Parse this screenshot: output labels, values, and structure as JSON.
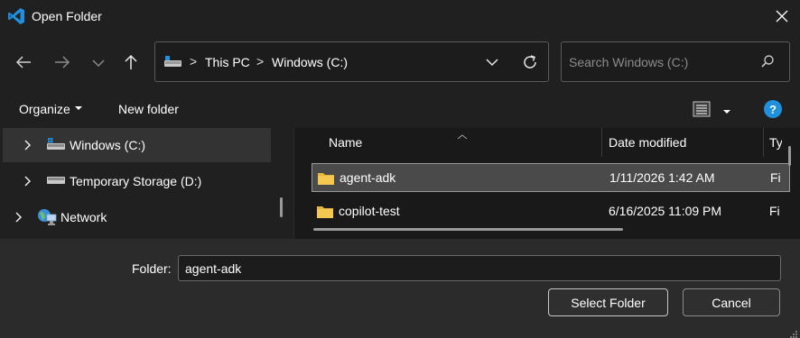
{
  "window": {
    "title": "Open Folder",
    "app_icon": "vscode-icon",
    "close_icon": "close-icon"
  },
  "navigation": {
    "back_icon": "arrow-left-icon",
    "forward_icon": "arrow-right-icon",
    "recent_icon": "chevron-down-icon",
    "up_icon": "arrow-up-icon",
    "address": {
      "icon": "drive-icon",
      "crumbs": [
        "This PC",
        "Windows (C:)"
      ],
      "separator": ">",
      "dropdown_icon": "chevron-down-icon",
      "refresh_icon": "refresh-icon"
    },
    "search": {
      "placeholder": "Search Windows (C:)",
      "value": "",
      "icon": "search-icon"
    }
  },
  "toolbar": {
    "organize_label": "Organize",
    "new_folder_label": "New folder",
    "view_icon": "details-view-icon",
    "help_label": "?"
  },
  "nav_pane": {
    "items": [
      {
        "label": "Windows (C:)",
        "icon": "windows-drive-icon",
        "selected": true
      },
      {
        "label": "Temporary Storage (D:)",
        "icon": "drive-icon",
        "selected": false
      },
      {
        "label": "Network",
        "icon": "network-icon",
        "selected": false
      }
    ]
  },
  "file_list": {
    "columns": [
      "Name",
      "Date modified",
      "Ty"
    ],
    "rows": [
      {
        "name": "agent-adk",
        "date": "1/11/2026 1:42 AM",
        "type": "Fi",
        "icon": "folder-icon",
        "selected": true
      },
      {
        "name": "copilot-test",
        "date": "6/16/2025 11:09 PM",
        "type": "Fi",
        "icon": "folder-icon",
        "selected": false
      }
    ]
  },
  "footer": {
    "folder_label": "Folder:",
    "folder_value": "agent-adk",
    "select_label": "Select Folder",
    "cancel_label": "Cancel"
  },
  "colors": {
    "background": "#202020",
    "file_pane": "#191919",
    "footer": "#2b2b2b",
    "accent": "#1f8fde",
    "folder": "#f0c44c"
  }
}
